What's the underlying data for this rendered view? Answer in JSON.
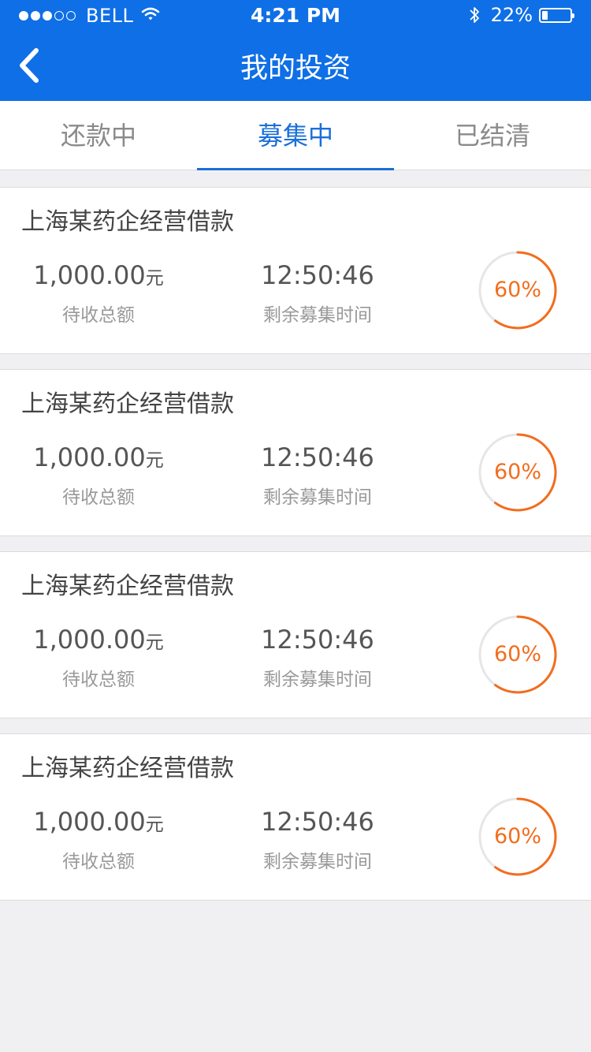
{
  "status_bar": {
    "signal_filled": 3,
    "signal_total": 5,
    "carrier": "BELL",
    "time": "4:21 PM",
    "battery_text": "22%",
    "battery_level": 0.22
  },
  "nav": {
    "back_icon": "chevron-left-icon",
    "title": "我的投资"
  },
  "tabs": [
    {
      "label": "还款中",
      "active": false
    },
    {
      "label": "募集中",
      "active": true
    },
    {
      "label": "已结清",
      "active": false
    }
  ],
  "colors": {
    "header_bg": "#0f6fe6",
    "accent": "#1a6fd9",
    "progress": "#f26d1e",
    "progress_track": "#e6e6e6"
  },
  "investments": [
    {
      "title": "上海某药企经营借款",
      "amount": "1,000.00",
      "unit": "元",
      "amount_label": "待收总额",
      "time": "12:50:46",
      "time_label": "剩余募集时间",
      "progress_text": "60%",
      "progress": 0.6
    },
    {
      "title": "上海某药企经营借款",
      "amount": "1,000.00",
      "unit": "元",
      "amount_label": "待收总额",
      "time": "12:50:46",
      "time_label": "剩余募集时间",
      "progress_text": "60%",
      "progress": 0.6
    },
    {
      "title": "上海某药企经营借款",
      "amount": "1,000.00",
      "unit": "元",
      "amount_label": "待收总额",
      "time": "12:50:46",
      "time_label": "剩余募集时间",
      "progress_text": "60%",
      "progress": 0.6
    },
    {
      "title": "上海某药企经营借款",
      "amount": "1,000.00",
      "unit": "元",
      "amount_label": "待收总额",
      "time": "12:50:46",
      "time_label": "剩余募集时间",
      "progress_text": "60%",
      "progress": 0.6
    }
  ]
}
